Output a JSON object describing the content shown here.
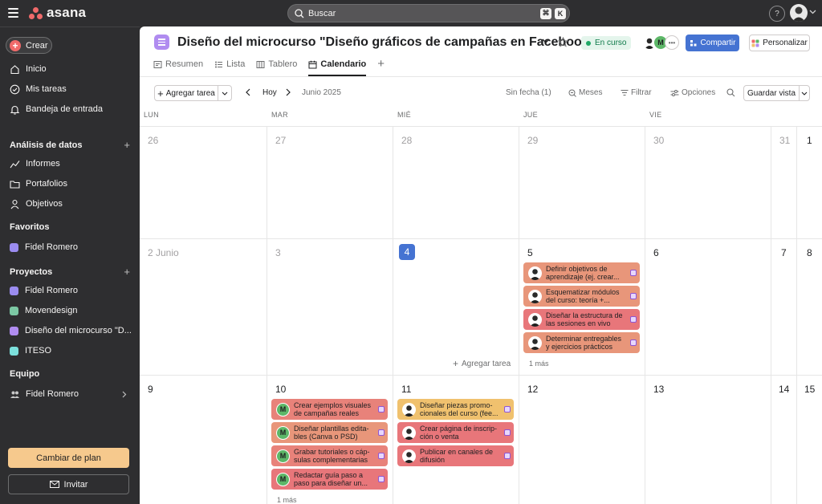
{
  "app": {
    "name": "asana",
    "search_placeholder": "Buscar",
    "kbd1": "⌘",
    "kbd2": "K",
    "help": "?"
  },
  "sidebar": {
    "create": "Crear",
    "main_items": [
      {
        "label": "Inicio",
        "icon": "home-icon"
      },
      {
        "label": "Mis tareas",
        "icon": "check-circle-icon"
      },
      {
        "label": "Bandeja de entrada",
        "icon": "bell-icon"
      }
    ],
    "analytics": {
      "title": "Análisis de datos",
      "items": [
        {
          "label": "Informes",
          "icon": "chart-line-icon"
        },
        {
          "label": "Portafolios",
          "icon": "folder-icon"
        },
        {
          "label": "Objetivos",
          "icon": "person-goal-icon"
        }
      ]
    },
    "favorites": {
      "title": "Favoritos",
      "items": [
        {
          "label": "Fidel Romero",
          "color": "#9b8cf0"
        }
      ]
    },
    "projects": {
      "title": "Proyectos",
      "items": [
        {
          "label": "Fidel Romero",
          "color": "#9b8cf0"
        },
        {
          "label": "Movendesign",
          "color": "#7cc8a4"
        },
        {
          "label": "Diseño del microcurso \"D...",
          "color": "#b08cf0"
        },
        {
          "label": "ITESO",
          "color": "#7ce0dc"
        }
      ]
    },
    "team": {
      "title": "Equipo",
      "item": "Fidel Romero"
    },
    "upgrade": "Cambiar de plan",
    "invite": "Invitar"
  },
  "project": {
    "title": "Diseño del microcurso \"Diseño gráficos de campañas en Facebook\"",
    "status": "En curso",
    "share": "Compartir",
    "customize": "Personalizar",
    "tabs": [
      "Resumen",
      "Lista",
      "Tablero",
      "Calendario"
    ]
  },
  "toolbar": {
    "add_task": "Agregar tarea",
    "today": "Hoy",
    "month": "Junio 2025",
    "no_date": "Sin fecha (1)",
    "months": "Meses",
    "filter": "Filtrar",
    "options": "Opciones",
    "save_view": "Guardar vista"
  },
  "calendar": {
    "days": [
      "LUN",
      "MAR",
      "MIÉ",
      "JUE",
      "VIE"
    ],
    "week1": [
      "26",
      "27",
      "28",
      "29",
      "30",
      "31",
      "1"
    ],
    "week2": [
      "2 Junio",
      "3",
      "4",
      "5",
      "6",
      "7",
      "8"
    ],
    "week3": [
      "9",
      "10",
      "11",
      "12",
      "13",
      "14",
      "15"
    ],
    "cell_add_task": "Agregar tarea",
    "thu_tasks": [
      {
        "text": "Definir objetivos de aprendizaje (ej. crear...",
        "color": "#e8967a"
      },
      {
        "text": "Esquematizar módulos del curso: teoría +...",
        "color": "#e8967a"
      },
      {
        "text": "Diseñar la estructura de las sesiones en vivo",
        "color": "#e8767a"
      },
      {
        "text": "Determinar entregables y ejercicios prácticos",
        "color": "#e8967a"
      }
    ],
    "thu_more": "1 más",
    "tue_tasks": [
      {
        "text": "Crear ejemplos visuales de campañas reales",
        "color": "#e8827a"
      },
      {
        "text": "Diseñar plantillas edita-bles (Canva o PSD)",
        "color": "#e8967a"
      },
      {
        "text": "Grabar tutoriales o cáp-sulas complementarias",
        "color": "#e8827a"
      },
      {
        "text": "Redactar guía paso a paso para diseñar un...",
        "color": "#e8767a"
      }
    ],
    "tue_more": "1 más",
    "wed_tasks": [
      {
        "text": "Diseñar piezas promo-cionales del curso (fee...",
        "color": "#f0c16e"
      },
      {
        "text": "Crear página de inscrip-ción o venta",
        "color": "#e8767a"
      },
      {
        "text": "Publicar en canales de difusión",
        "color": "#e8767a"
      }
    ]
  }
}
